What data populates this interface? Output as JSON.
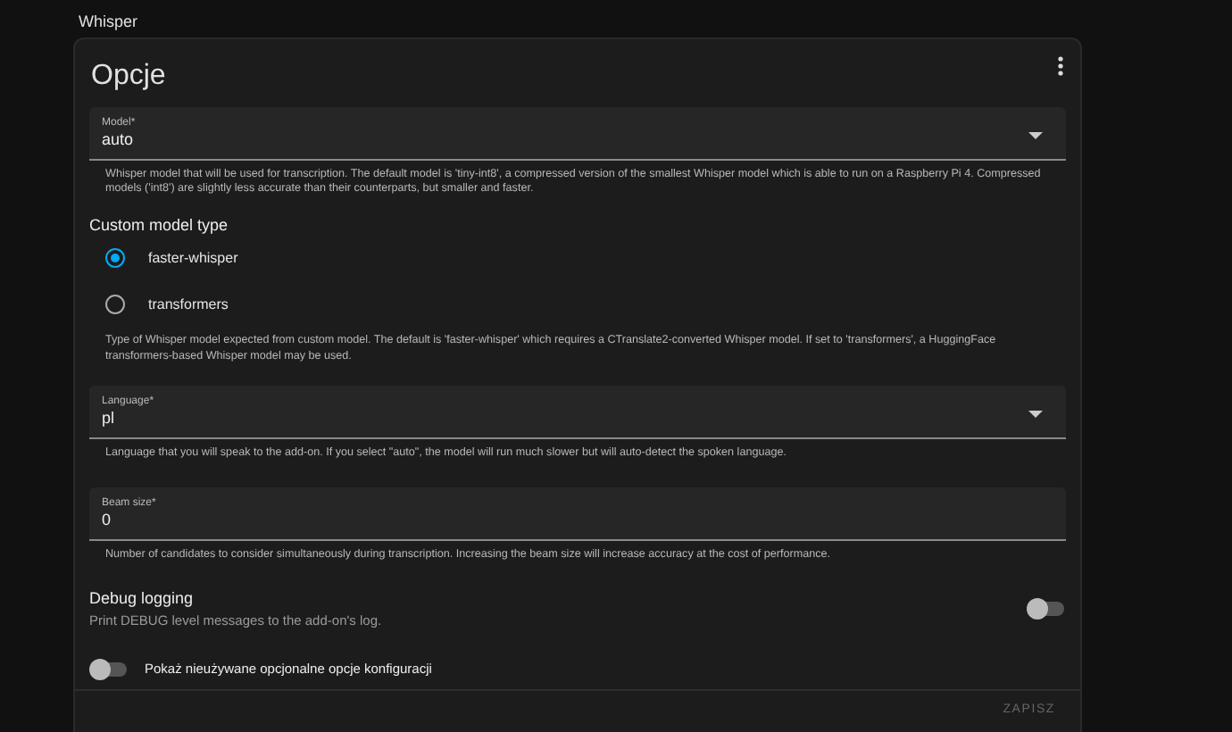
{
  "header": {
    "title": "Whisper"
  },
  "card": {
    "title": "Opcje",
    "model": {
      "label": "Model*",
      "value": "auto",
      "helper": "Whisper model that will be used for transcription. The default model is 'tiny-int8', a compressed version of the smallest Whisper model which is able to run on a Raspberry Pi 4. Compressed models ('int8') are slightly less accurate than their counterparts, but smaller and faster."
    },
    "custom_model_type": {
      "label": "Custom model type",
      "options": [
        {
          "label": "faster-whisper",
          "selected": true
        },
        {
          "label": "transformers",
          "selected": false
        }
      ],
      "helper": "Type of Whisper model expected from custom model. The default is 'faster-whisper' which requires a CTranslate2-converted Whisper model. If set to 'transformers', a HuggingFace transformers-based Whisper model may be used."
    },
    "language": {
      "label": "Language*",
      "value": "pl",
      "helper": "Language that you will speak to the add-on. If you select \"auto\", the model will run much slower but will auto-detect the spoken language."
    },
    "beam_size": {
      "label": "Beam size*",
      "value": "0",
      "helper": "Number of candidates to consider simultaneously during transcription. Increasing the beam size will increase accuracy at the cost of performance."
    },
    "debug_logging": {
      "label": "Debug logging",
      "description": "Print DEBUG level messages to the add-on's log.",
      "on": false
    },
    "show_unused": {
      "label": "Pokaż nieużywane opcjonalne opcje konfiguracji",
      "on": false
    },
    "save_button": "ZAPISZ"
  }
}
